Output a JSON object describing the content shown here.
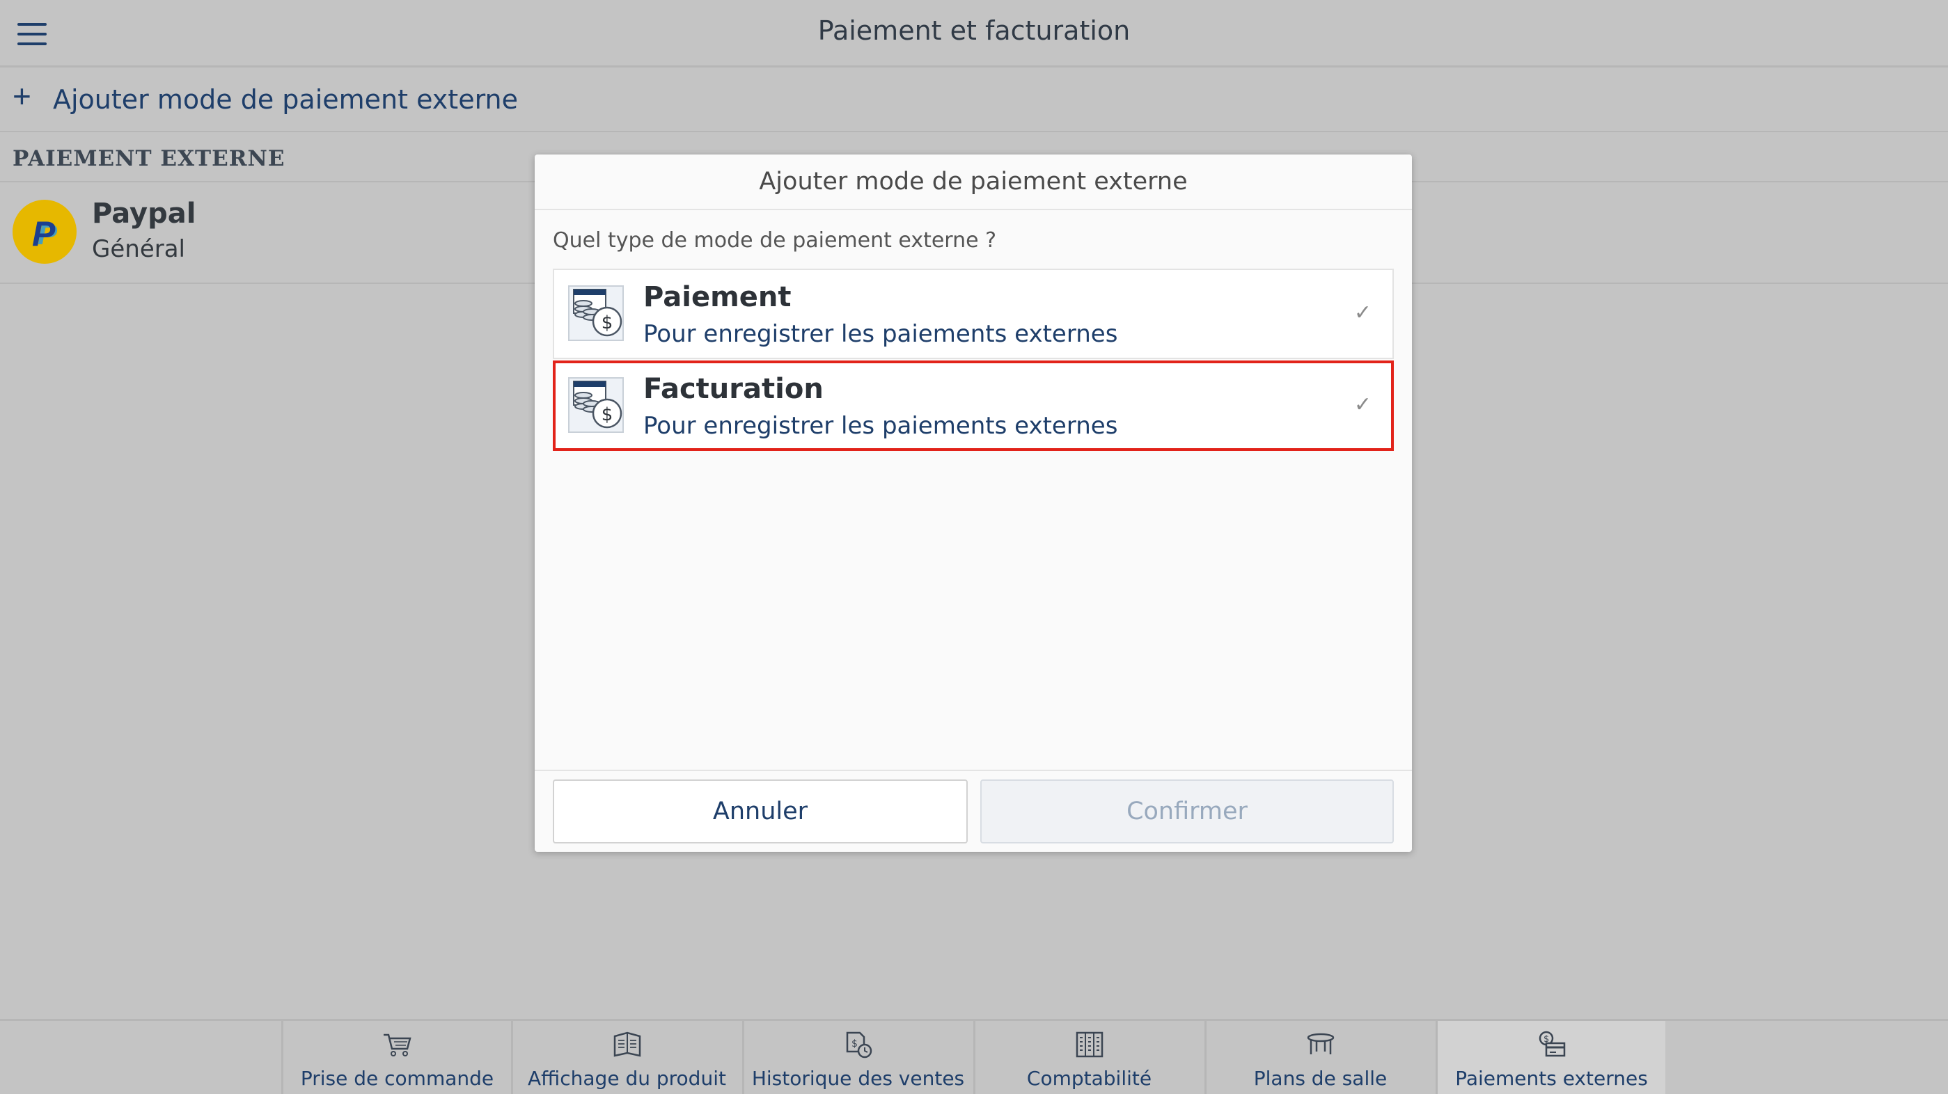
{
  "header": {
    "title": "Paiement et facturation"
  },
  "add_external": {
    "label": "Ajouter mode de paiement externe"
  },
  "section": {
    "title": "PAIEMENT EXTERNE"
  },
  "payments": [
    {
      "name": "Paypal",
      "subtitle": "Général"
    }
  ],
  "dialog": {
    "title": "Ajouter mode de paiement externe",
    "question": "Quel type de mode de paiement externe ?",
    "options": [
      {
        "name": "Paiement",
        "description": "Pour enregistrer les paiements externes",
        "highlighted": false
      },
      {
        "name": "Facturation",
        "description": "Pour enregistrer les paiements externes",
        "highlighted": true
      }
    ],
    "cancel_label": "Annuler",
    "confirm_label": "Confirmer"
  },
  "bottom_nav": [
    {
      "label": "Prise de commande",
      "icon": "cart-icon",
      "active": false
    },
    {
      "label": "Affichage du produit",
      "icon": "product-display-icon",
      "active": false
    },
    {
      "label": "Historique des ventes",
      "icon": "sales-history-icon",
      "active": false
    },
    {
      "label": "Comptabilité",
      "icon": "accounting-icon",
      "active": false
    },
    {
      "label": "Plans de salle",
      "icon": "table-icon",
      "active": false
    },
    {
      "label": "Paiements externes",
      "icon": "external-payment-icon",
      "active": true
    }
  ],
  "colors": {
    "accent": "#1e3e6a",
    "highlight_border": "#e2231a",
    "overlay_background": "#c4c4c4",
    "paypal_yellow": "#e6b800"
  }
}
